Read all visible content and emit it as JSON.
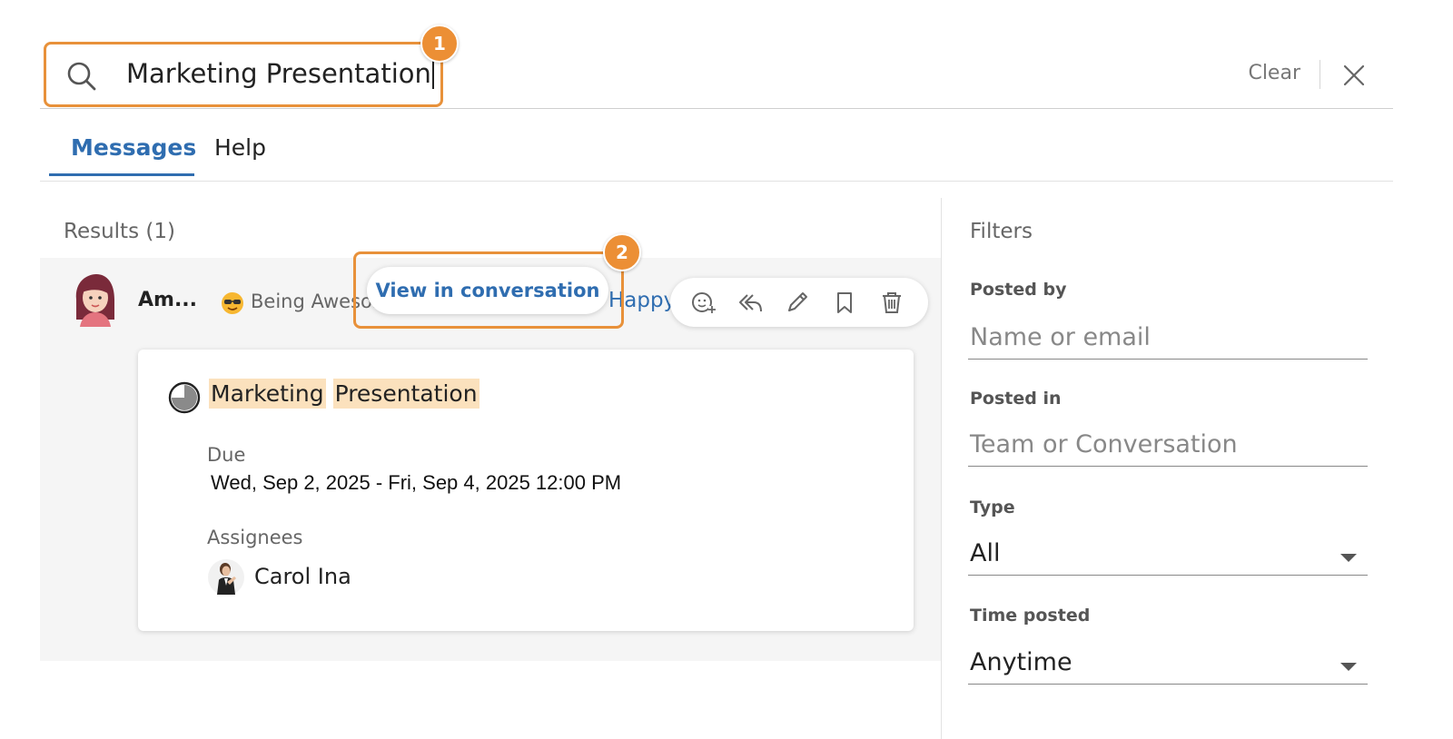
{
  "search": {
    "value": "Marketing Presentation",
    "clear_label": "Clear"
  },
  "callouts": {
    "one": "1",
    "two": "2"
  },
  "tabs": [
    {
      "label": "Messages",
      "active": true
    },
    {
      "label": "Help",
      "active": false
    }
  ],
  "results": {
    "label": "Results (1)",
    "item": {
      "author": "Am...",
      "status_emoji": "sunglasses-emoji-icon",
      "status_text": "Being Aweso...",
      "conversation_partial": "Happy",
      "view_in_conversation_label": "View in conversation",
      "actions": [
        "add-reaction-icon",
        "reply-icon",
        "edit-icon",
        "bookmark-icon",
        "delete-icon"
      ],
      "task": {
        "title_word_1": "Marketing",
        "title_word_2": "Presentation",
        "due_label": "Due",
        "due_value": "Wed, Sep 2, 2025 - Fri, Sep 4, 2025 12:00 PM",
        "assignees_label": "Assignees",
        "assignee_name": "Carol Ina"
      }
    }
  },
  "filters": {
    "title": "Filters",
    "posted_by": {
      "label": "Posted by",
      "placeholder": "Name or email"
    },
    "posted_in": {
      "label": "Posted in",
      "placeholder": "Team or Conversation"
    },
    "type": {
      "label": "Type",
      "value": "All"
    },
    "time_posted": {
      "label": "Time posted",
      "value": "Anytime"
    }
  },
  "colors": {
    "accent": "#2f6db0",
    "callout": "#ec8f35",
    "highlight": "#fbe1bd"
  }
}
